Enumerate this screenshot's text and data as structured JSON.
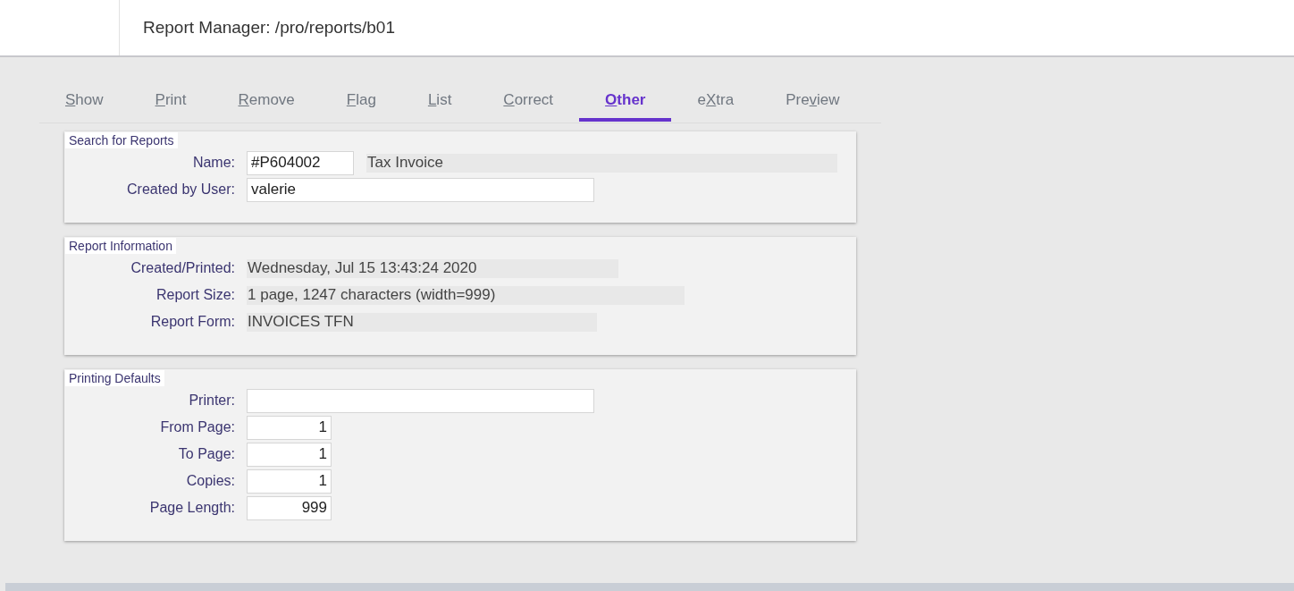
{
  "header": {
    "title": "Report Manager: /pro/reports/b01"
  },
  "tabs": [
    {
      "key": "S",
      "after": "how",
      "selected": false
    },
    {
      "key": "P",
      "after": "rint",
      "selected": false
    },
    {
      "key": "R",
      "after": "emove",
      "selected": false
    },
    {
      "key": "F",
      "after": "lag",
      "selected": false
    },
    {
      "key": "L",
      "after": "ist",
      "selected": false
    },
    {
      "key": "C",
      "after": "orrect",
      "selected": false
    },
    {
      "key": "O",
      "after": "ther",
      "selected": true
    },
    {
      "before": "e",
      "key": "X",
      "after": "tra",
      "selected": false
    },
    {
      "before": "Pre",
      "key": "v",
      "after": "iew",
      "selected": false
    }
  ],
  "sections": [
    {
      "legend": "Search for Reports",
      "rows": [
        {
          "label": "Name:",
          "fields": [
            {
              "kind": "code",
              "value": "#P604002"
            },
            {
              "kind": "display",
              "value": "Tax Invoice"
            }
          ]
        },
        {
          "label": "Created by User:",
          "fields": [
            {
              "kind": "text",
              "value": "valerie"
            }
          ]
        }
      ]
    },
    {
      "legend": "Report Information",
      "rows": [
        {
          "label": "Created/Printed:",
          "fields": [
            {
              "kind": "display",
              "value": "Wednesday, Jul 15 13:43:24 2020"
            }
          ]
        },
        {
          "label": "Report Size:",
          "fields": [
            {
              "kind": "display",
              "value": "1 page, 1247 characters (width=999)"
            }
          ]
        },
        {
          "label": "Report Form:",
          "fields": [
            {
              "kind": "display",
              "value": "INVOICES TFN"
            }
          ]
        }
      ]
    },
    {
      "legend": "Printing Defaults",
      "rows": [
        {
          "label": "Printer:",
          "fields": [
            {
              "kind": "text"
            }
          ]
        },
        {
          "label": "From Page:",
          "fields": [
            {
              "kind": "number",
              "value": "1"
            }
          ]
        },
        {
          "label": "To Page:",
          "fields": [
            {
              "kind": "number",
              "value": "1"
            }
          ]
        },
        {
          "label": "Copies:",
          "fields": [
            {
              "kind": "number",
              "value": "1"
            }
          ]
        },
        {
          "label": "Page Length:",
          "fields": [
            {
              "kind": "number",
              "value": "999"
            }
          ]
        }
      ]
    }
  ]
}
